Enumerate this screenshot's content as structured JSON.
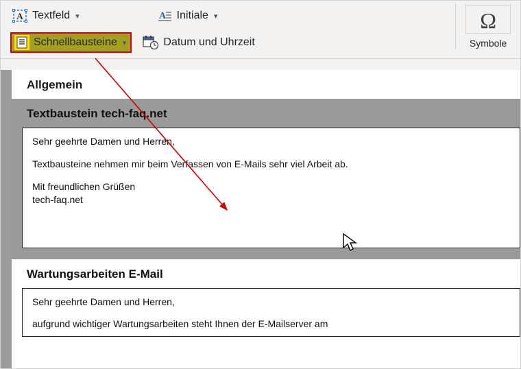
{
  "ribbon": {
    "row1": {
      "textfeld": "Textfeld",
      "initiale": "Initiale"
    },
    "row2": {
      "schnellbausteine": "Schnellbausteine",
      "datumuhrzeit": "Datum und Uhrzeit"
    },
    "symbols_group_label": "Symbole"
  },
  "gallery": {
    "category": "Allgemein",
    "entries": [
      {
        "title": "Textbaustein tech-faq.net",
        "lines": {
          "greeting": "Sehr geehrte Damen und Herren,",
          "body": "Textbausteine nehmen mir beim Verfassen von E-Mails sehr viel Arbeit ab.",
          "closing_line1": "Mit freundlichen Grüßen",
          "closing_line2": "tech-faq.net"
        }
      },
      {
        "title": "Wartungsarbeiten E-Mail",
        "lines": {
          "greeting": "Sehr geehrte Damen und Herren,",
          "body": "aufgrund wichtiger Wartungsarbeiten steht Ihnen der E-Mailserver am"
        }
      }
    ]
  }
}
